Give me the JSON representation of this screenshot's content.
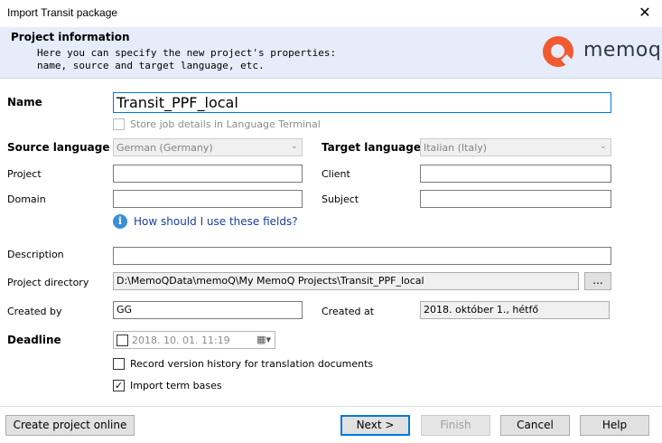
{
  "window": {
    "title": "Import Transit package",
    "close_glyph": "✕"
  },
  "header": {
    "title": "Project information",
    "description": "Here you can specify the new project's properties:\nname, source and target language, etc.",
    "logo_text": "memoq",
    "brand_color": "#f05a31"
  },
  "form": {
    "name_label": "Name",
    "name_value": "Transit_PPF_local",
    "store_job_label": "Store job details in Language Terminal",
    "source_language_label": "Source language",
    "source_language_value": "German (Germany)",
    "target_language_label": "Target language",
    "target_language_value": "Italian (Italy)",
    "project_label": "Project",
    "project_value": "",
    "client_label": "Client",
    "client_value": "",
    "domain_label": "Domain",
    "domain_value": "",
    "subject_label": "Subject",
    "subject_value": "",
    "help_link": "How should I use these fields?",
    "description_label": "Description",
    "description_value": "",
    "project_directory_label": "Project directory",
    "project_directory_value": "D:\\MemoQData\\memoQ\\My MemoQ Projects\\Transit_PPF_local",
    "browse_label": "...",
    "created_by_label": "Created by",
    "created_by_value": "GG",
    "created_at_label": "Created at",
    "created_at_value": "2018. október 1., hétfő",
    "deadline_label": "Deadline",
    "deadline_value": "2018. 10. 01. 11:19",
    "record_version_label": "Record version history for translation documents",
    "record_version_checked": false,
    "import_term_label": "Import term bases",
    "import_term_checked": true
  },
  "buttons": {
    "create_online": "Create project online",
    "next": "Next >",
    "finish": "Finish",
    "cancel": "Cancel",
    "help": "Help"
  }
}
